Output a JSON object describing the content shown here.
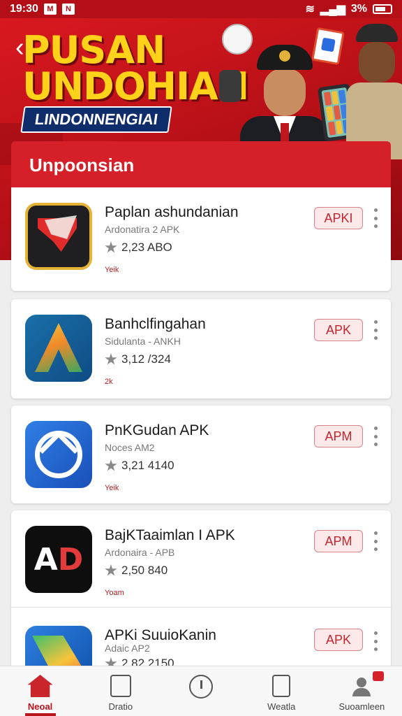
{
  "status_bar": {
    "time": "19:30",
    "left_chips": [
      "M",
      "N"
    ],
    "right_text": "3%"
  },
  "hero": {
    "title_line1": "PUSAN",
    "title_line2": "UNDOHIAN",
    "subtitle": "LINDONNENGIAI"
  },
  "section": {
    "title": "Unpoonsian"
  },
  "apps": [
    {
      "name": "Paplan ashundanian",
      "subtitle": "Ardonatira 2 APK",
      "rating": "2,23 ABO",
      "meta": "Yeik",
      "button": "APKI"
    },
    {
      "name": "Banhclfingahan",
      "subtitle": "Sidulanta - ANKH",
      "rating": "3,12 /324",
      "meta": "2k",
      "button": "APK"
    },
    {
      "name": "PnKGudan APK",
      "subtitle": "Noces AM2",
      "rating": "3,21 4140",
      "meta": "Yeik",
      "button": "APM"
    },
    {
      "name": "BajKTaaimlan I APK",
      "subtitle": "Ardonaira - APB",
      "rating": "2,50 840",
      "meta": "Yoam",
      "button": "APM"
    },
    {
      "name": "APKi SuuioKanin",
      "subtitle": "Adaic AP2",
      "rating": "2,82 2150",
      "meta": "",
      "button": "APK"
    }
  ],
  "nav": [
    {
      "label": "Neoal",
      "icon": "home-icon"
    },
    {
      "label": "Dratio",
      "icon": "box-icon"
    },
    {
      "label": "",
      "icon": "clock-icon"
    },
    {
      "label": "Weatla",
      "icon": "document-icon"
    },
    {
      "label": "Suoamleen",
      "icon": "user-icon"
    }
  ],
  "colors": {
    "brand_red": "#c9252b",
    "accent_yellow": "#ffd21a",
    "navy": "#0f2d6b"
  }
}
